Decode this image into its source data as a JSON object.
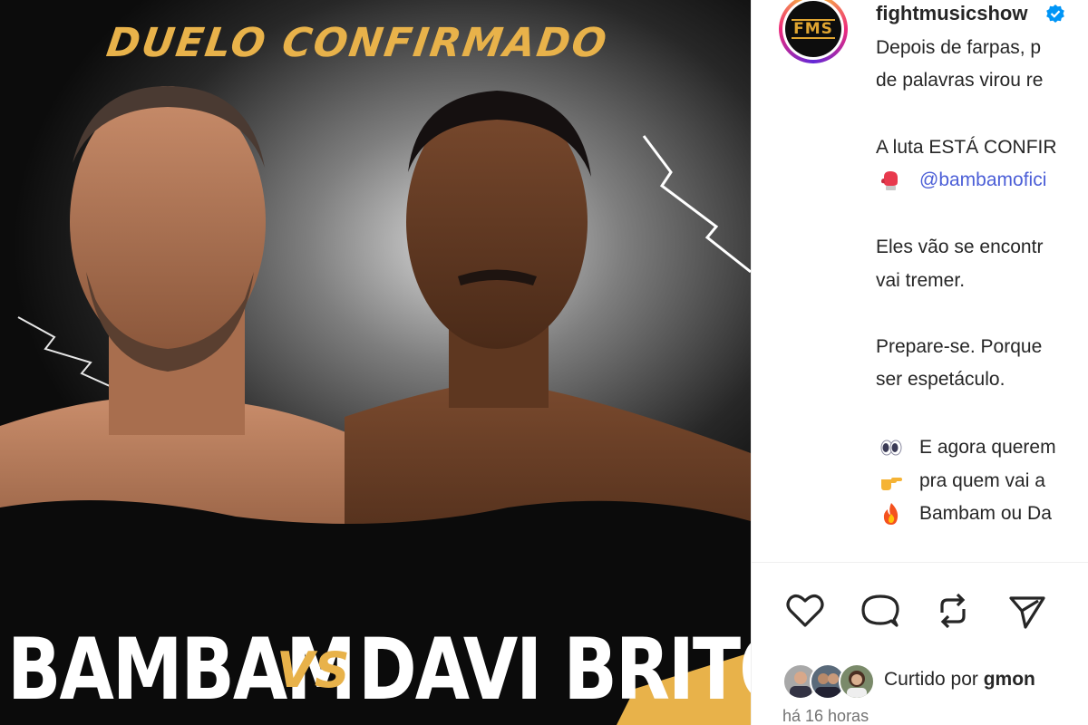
{
  "post": {
    "poster": {
      "headline": "DUELO CONFIRMADO",
      "fighter_left": "BAMBAM",
      "vs": "VS",
      "fighter_right": "DAVI BRITO"
    }
  },
  "header": {
    "username": "fightmusicshow",
    "avatar_logo": "FMS",
    "verified_icon": "verified-badge-icon"
  },
  "caption": {
    "lines": [
      "Depois de farpas, p",
      "de palavras virou re",
      "A luta ESTÁ CONFIR",
      "Eles vão se encontr",
      "vai tremer.",
      "Prepare-se. Porque",
      "ser espetáculo."
    ],
    "mention": "@bambamofici",
    "emoji_lines": [
      {
        "icon": "eyes-emoji",
        "text": "E agora querem"
      },
      {
        "icon": "pointing-hand-emoji",
        "text": "pra quem vai a"
      },
      {
        "icon": "fire-emoji",
        "text": "Bambam ou Da"
      }
    ],
    "mention_icon": "boxing-glove-emoji"
  },
  "actions": {
    "like": "heart-icon",
    "comment": "comment-icon",
    "repost": "repost-icon",
    "share": "share-icon"
  },
  "likes": {
    "prefix": "Curtido por",
    "user": "gmon"
  },
  "timestamp": "há 16 horas",
  "colors": {
    "accent_gold": "#e8b24a",
    "mention_blue": "#4c5fd7",
    "verified_blue": "#0095f6"
  }
}
